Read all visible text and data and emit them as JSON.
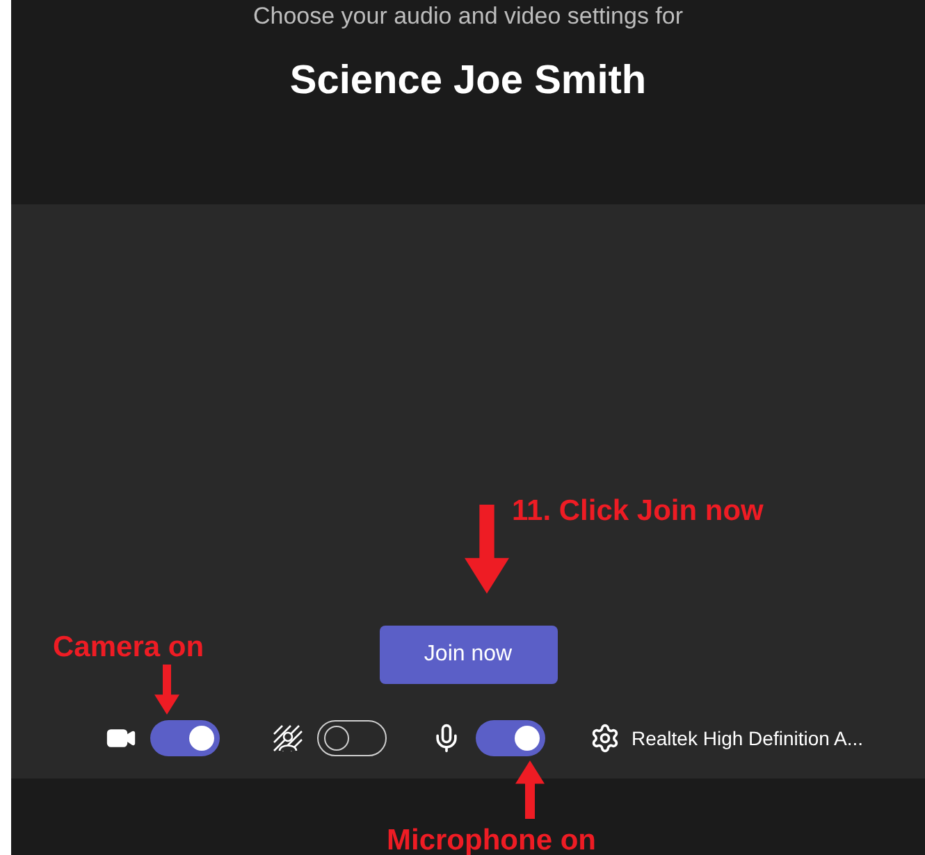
{
  "header": {
    "subtitle": "Choose your audio and video settings for",
    "title": "Science Joe Smith"
  },
  "join_button": {
    "label": "Join now"
  },
  "controls": [
    {
      "kind": "camera",
      "on": true
    },
    {
      "kind": "background",
      "on": false
    },
    {
      "kind": "microphone",
      "on": true
    }
  ],
  "audio_device": {
    "label": "Realtek High Definition A..."
  },
  "annotations": [
    {
      "kind": "join",
      "text": "11. Click Join now"
    },
    {
      "kind": "camera",
      "text": "Camera on"
    },
    {
      "kind": "microphone",
      "text": "Microphone on"
    }
  ]
}
